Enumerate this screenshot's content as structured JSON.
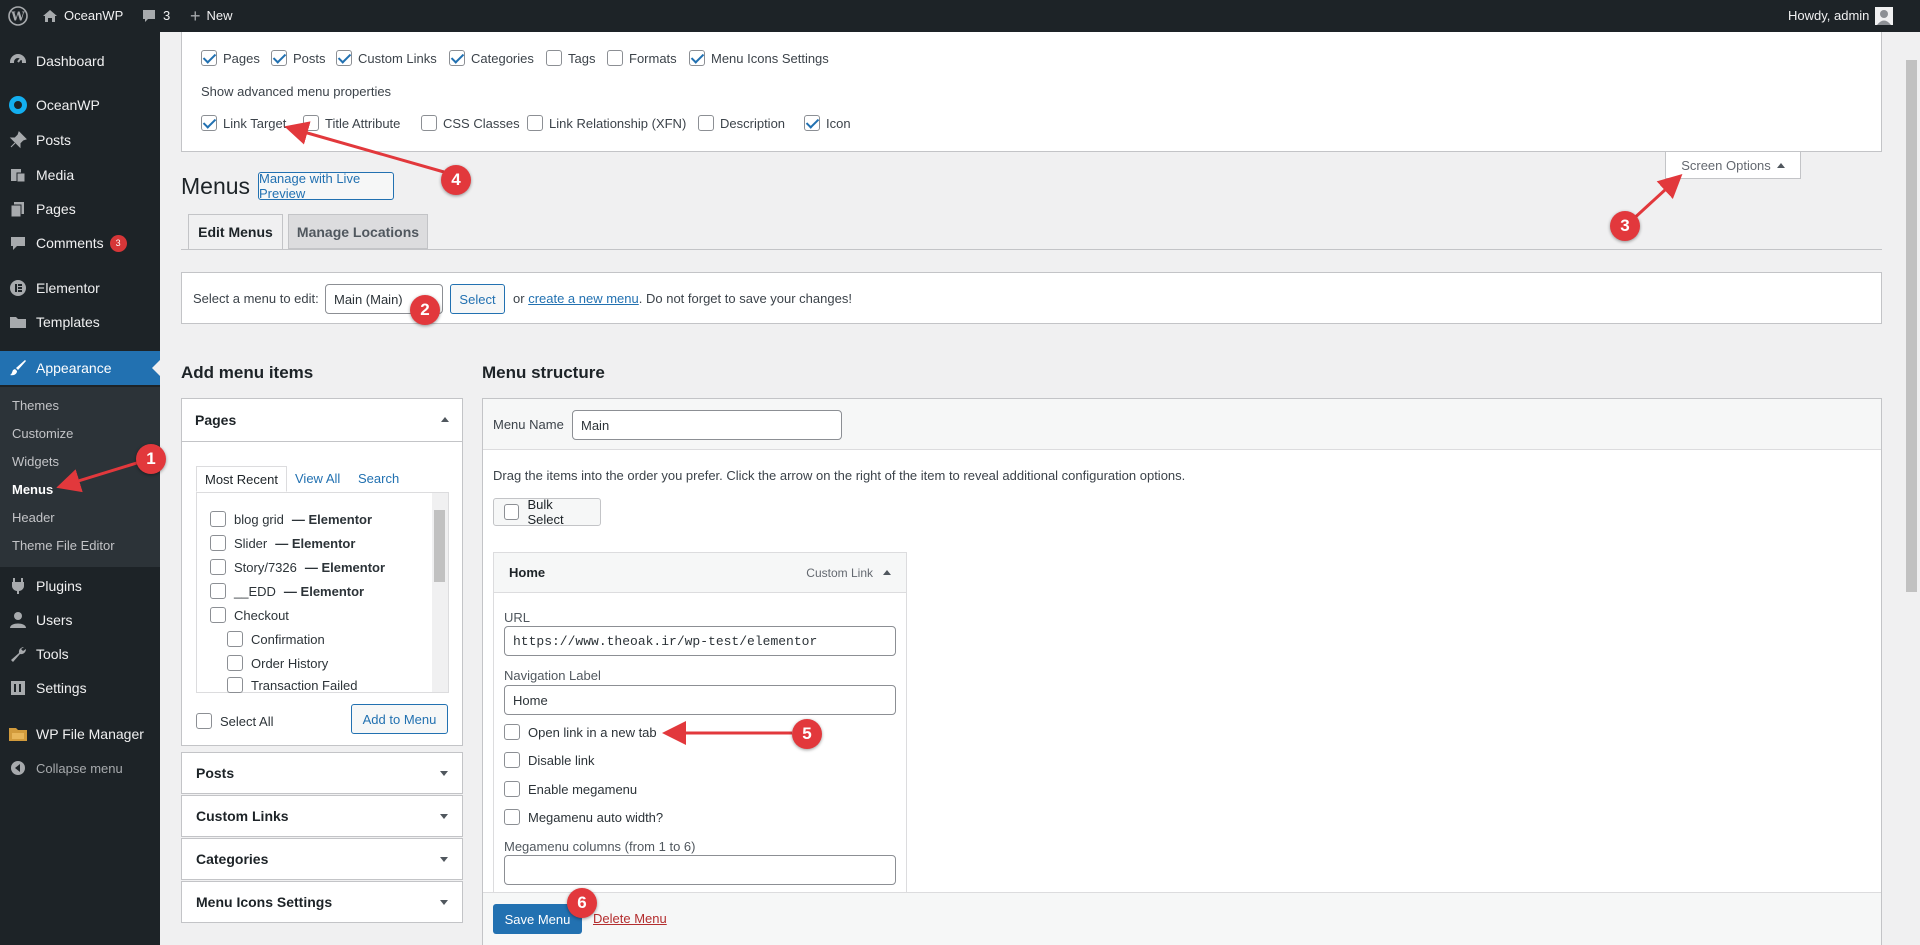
{
  "adminbar": {
    "site_name": "OceanWP",
    "comments_count": "3",
    "new_label": "New",
    "greeting": "Howdy, admin"
  },
  "sidebar": {
    "items": [
      {
        "label": "Dashboard",
        "icon": "dashboard-icon"
      },
      {
        "label": "OceanWP",
        "icon": "oceanwp-icon"
      },
      {
        "label": "Posts",
        "icon": "pin-icon"
      },
      {
        "label": "Media",
        "icon": "media-icon"
      },
      {
        "label": "Pages",
        "icon": "pages-icon"
      },
      {
        "label": "Comments",
        "icon": "comment-icon",
        "badge": "3"
      },
      {
        "label": "Elementor",
        "icon": "elementor-icon"
      },
      {
        "label": "Templates",
        "icon": "folder-icon"
      },
      {
        "label": "Appearance",
        "icon": "brush-icon"
      },
      {
        "label": "Plugins",
        "icon": "plugin-icon"
      },
      {
        "label": "Users",
        "icon": "user-icon"
      },
      {
        "label": "Tools",
        "icon": "wrench-icon"
      },
      {
        "label": "Settings",
        "icon": "settings-icon"
      },
      {
        "label": "WP File Manager",
        "icon": "file-manager-icon"
      },
      {
        "label": "Collapse menu",
        "icon": "collapse-icon"
      }
    ],
    "submenu": [
      "Themes",
      "Customize",
      "Widgets",
      "Menus",
      "Header",
      "Theme File Editor"
    ]
  },
  "screen_options": {
    "boxes": [
      {
        "label": "Pages",
        "checked": true
      },
      {
        "label": "Posts",
        "checked": true
      },
      {
        "label": "Custom Links",
        "checked": true
      },
      {
        "label": "Categories",
        "checked": true
      },
      {
        "label": "Tags",
        "checked": false
      },
      {
        "label": "Formats",
        "checked": false
      },
      {
        "label": "Menu Icons Settings",
        "checked": true
      }
    ],
    "advanced_heading": "Show advanced menu properties",
    "advanced": [
      {
        "label": "Link Target",
        "checked": true
      },
      {
        "label": "Title Attribute",
        "checked": false
      },
      {
        "label": "CSS Classes",
        "checked": false
      },
      {
        "label": "Link Relationship (XFN)",
        "checked": false
      },
      {
        "label": "Description",
        "checked": false
      },
      {
        "label": "Icon",
        "checked": true
      }
    ],
    "tab_label": "Screen Options"
  },
  "page": {
    "title": "Menus",
    "live_preview": "Manage with Live Preview",
    "tabs": [
      "Edit Menus",
      "Manage Locations"
    ]
  },
  "select_menu": {
    "label": "Select a menu to edit:",
    "value": "Main (Main)",
    "button": "Select",
    "or": "or",
    "create_link": "create a new menu",
    "suffix": ". Do not forget to save your changes!"
  },
  "add_items": {
    "heading": "Add menu items",
    "pages_panel": "Pages",
    "tabs": [
      "Most Recent",
      "View All",
      "Search"
    ],
    "pages": [
      {
        "name": "blog grid",
        "suffix": "— Elementor",
        "indent": false
      },
      {
        "name": "Slider",
        "suffix": "— Elementor",
        "indent": false
      },
      {
        "name": "Story/7326",
        "suffix": "— Elementor",
        "indent": false
      },
      {
        "name": "__EDD",
        "suffix": "— Elementor",
        "indent": false
      },
      {
        "name": "Checkout",
        "suffix": "",
        "indent": false
      },
      {
        "name": "Confirmation",
        "suffix": "",
        "indent": true
      },
      {
        "name": "Order History",
        "suffix": "",
        "indent": true
      },
      {
        "name": "Transaction Failed",
        "suffix": "",
        "indent": true
      }
    ],
    "select_all": "Select All",
    "add_button": "Add to Menu",
    "panels": [
      "Posts",
      "Custom Links",
      "Categories",
      "Menu Icons Settings"
    ]
  },
  "structure": {
    "heading": "Menu structure",
    "name_label": "Menu Name",
    "name_value": "Main",
    "instructions": "Drag the items into the order you prefer. Click the arrow on the right of the item to reveal additional configuration options.",
    "bulk_select": "Bulk Select",
    "item": {
      "title": "Home",
      "type": "Custom Link",
      "url_label": "URL",
      "url_value": "https://www.theoak.ir/wp-test/elementor",
      "nav_label": "Navigation Label",
      "nav_value": "Home",
      "options": [
        "Open link in a new tab",
        "Disable link",
        "Enable megamenu",
        "Megamenu auto width?"
      ],
      "columns_label": "Megamenu columns (from 1 to 6)"
    },
    "save_button": "Save Menu",
    "delete_link": "Delete Menu"
  },
  "annotations": [
    "1",
    "2",
    "3",
    "4",
    "5",
    "6"
  ],
  "colors": {
    "accent": "#2271b1",
    "marker": "#e2383c",
    "adminbar": "#1d2327"
  }
}
